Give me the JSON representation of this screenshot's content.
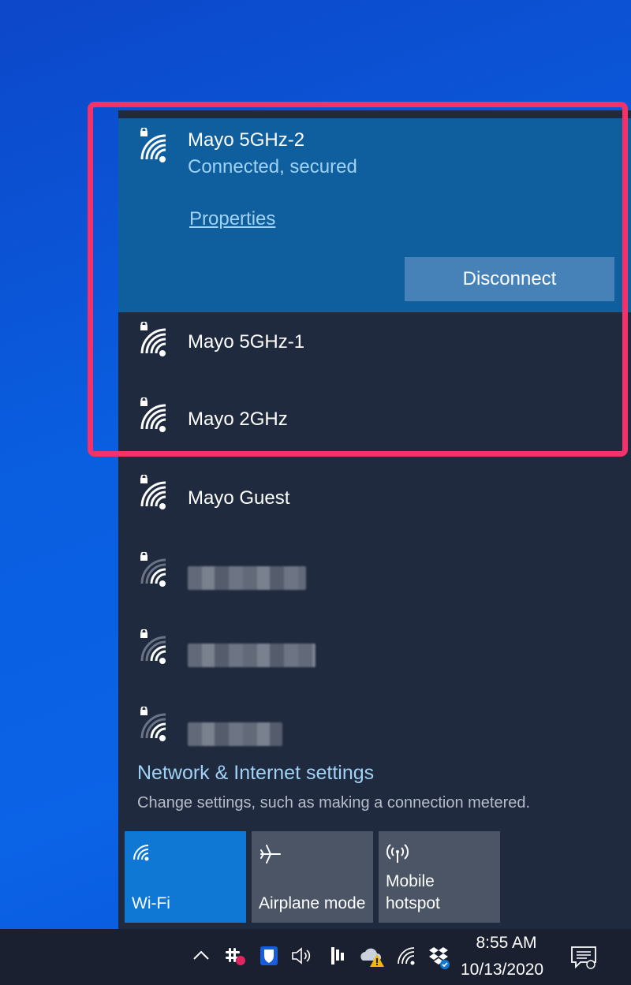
{
  "networks": [
    {
      "name": "Mayo 5GHz-2",
      "status": "Connected, secured",
      "properties_label": "Properties",
      "disconnect_label": "Disconnect",
      "connected": true,
      "secured": true,
      "signal": "full"
    },
    {
      "name": "Mayo 5GHz-1",
      "secured": true,
      "signal": "full"
    },
    {
      "name": "Mayo 2GHz",
      "secured": true,
      "signal": "full"
    },
    {
      "name": "Mayo Guest",
      "secured": true,
      "signal": "full"
    },
    {
      "name": "",
      "secured": true,
      "signal": "weak",
      "obscured": true
    },
    {
      "name": "",
      "secured": true,
      "signal": "weak",
      "obscured": true
    },
    {
      "name": "",
      "secured": true,
      "signal": "weak",
      "obscured": true
    }
  ],
  "settings": {
    "title": "Network & Internet settings",
    "subtitle": "Change settings, such as making a connection metered."
  },
  "quick_actions": [
    {
      "label": "Wi-Fi",
      "icon": "wifi-icon",
      "active": true
    },
    {
      "label": "Airplane mode",
      "icon": "airplane-icon",
      "active": false
    },
    {
      "label": "Mobile hotspot",
      "icon": "hotspot-icon",
      "active": false
    }
  ],
  "taskbar": {
    "time": "8:55 AM",
    "date": "10/13/2020",
    "tray_icons": [
      "chevron-up-icon",
      "slack-icon",
      "bitwarden-icon",
      "volume-icon",
      "app-icon",
      "onedrive-warning-icon",
      "wifi-icon",
      "dropbox-icon",
      "notifications-icon"
    ]
  },
  "colors": {
    "connected_bg": "#0f5e9e",
    "flyout_bg": "#1f2a3e",
    "accent_text": "#9fd2f5",
    "highlight": "#f5316c",
    "tile_active": "#0f78d4"
  }
}
